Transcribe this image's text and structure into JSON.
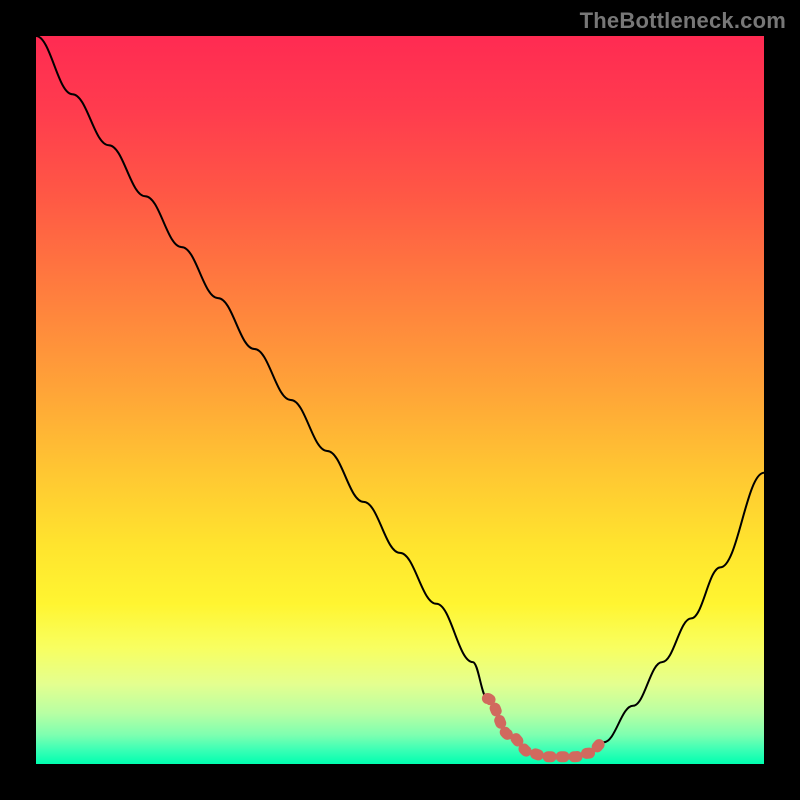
{
  "watermark": "TheBottleneck.com",
  "colors": {
    "page_bg": "#000000",
    "watermark": "#777777",
    "curve": "#000000",
    "highlight": "#d1695e",
    "gradient_top": "#ff2b52",
    "gradient_bottom": "#00ffb0"
  },
  "chart_data": {
    "type": "line",
    "title": "",
    "xlabel": "",
    "ylabel": "",
    "xlim": [
      0,
      100
    ],
    "ylim": [
      0,
      100
    ],
    "x": [
      0,
      5,
      10,
      15,
      20,
      25,
      30,
      35,
      40,
      45,
      50,
      55,
      60,
      62,
      65,
      68,
      70,
      72,
      74,
      76,
      78,
      82,
      86,
      90,
      94,
      100
    ],
    "values": [
      100,
      92,
      85,
      78,
      71,
      64,
      57,
      50,
      43,
      36,
      29,
      22,
      14,
      9,
      4,
      1.5,
      1,
      1,
      1,
      1.5,
      3,
      8,
      14,
      20,
      27,
      40
    ],
    "annotations": [
      {
        "kind": "highlight-segment",
        "x_range": [
          62,
          78
        ],
        "note": "dotted salmon segment along curve bottom"
      }
    ],
    "background": "vertical rainbow gradient (red→orange→yellow→green)"
  }
}
